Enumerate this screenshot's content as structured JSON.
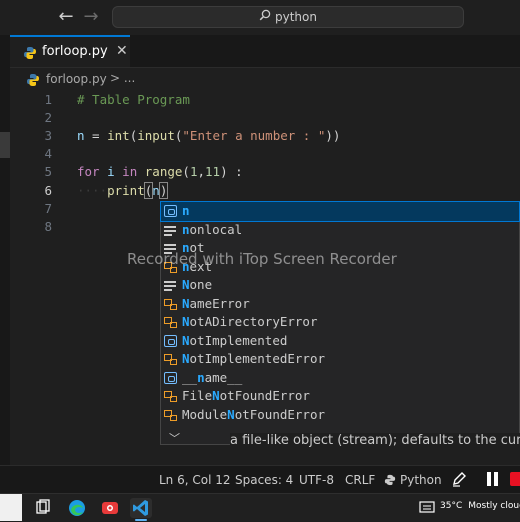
{
  "search": {
    "text": "python"
  },
  "tab": {
    "name": "forloop.py",
    "close": "✕"
  },
  "breadcrumb": {
    "file": "forloop.py",
    "separator": "> ..."
  },
  "editor": {
    "line_numbers": [
      "1",
      "2",
      "3",
      "4",
      "5",
      "6",
      "7",
      "8"
    ],
    "active_line": "6"
  },
  "suggest": {
    "items": [
      "n",
      "nonlocal",
      "not",
      "next",
      "None",
      "NameError",
      "NotADirectoryError",
      "NotImplemented",
      "NotImplementedError",
      "__name__",
      "FileNotFoundError",
      "ModuleNotFoundError"
    ],
    "more": "﹀"
  },
  "docs": {
    "text": "a file-like object (stream); defaults to the current"
  },
  "watermark": {
    "text": "Recorded with iTop Screen Recorder"
  },
  "status": {
    "position": "Ln 6, Col 12",
    "spaces": "Spaces: 4",
    "encoding": "UTF-8",
    "eol": "CRLF",
    "language": "Python"
  },
  "taskbar": {
    "temperature": "35°C",
    "condition": "Mostly cloudy"
  },
  "colors": {
    "accent": "#0078d4",
    "stop": "#e81123",
    "suggest_selected": "#04395e",
    "match": "#2aaaff"
  }
}
